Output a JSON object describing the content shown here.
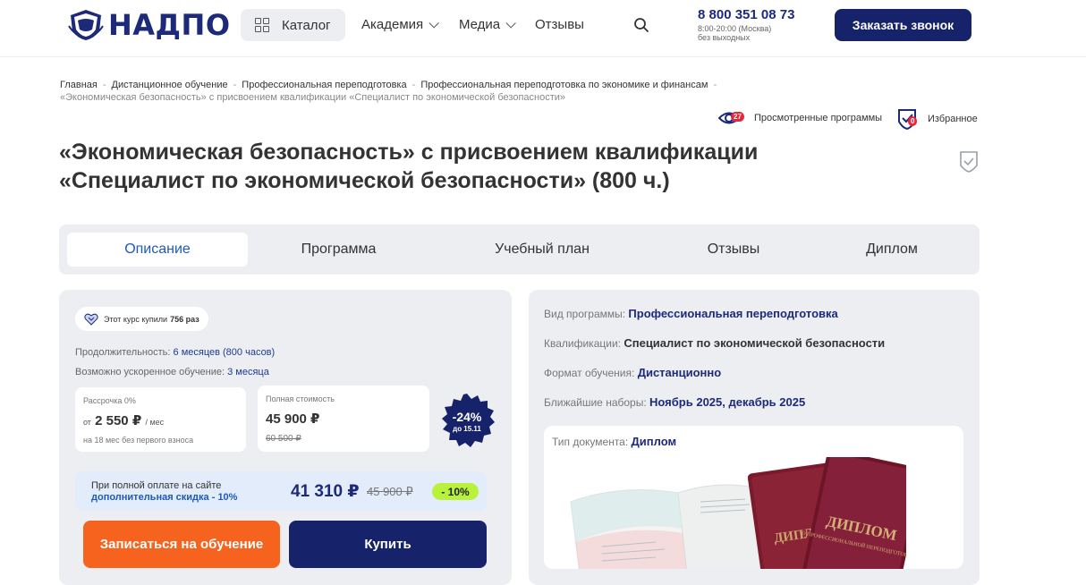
{
  "header": {
    "logo_text": "НАДПО",
    "catalog_label": "Каталог",
    "nav": [
      {
        "label": "Академия",
        "has_dropdown": true
      },
      {
        "label": "Медиа",
        "has_dropdown": true
      },
      {
        "label": "Отзывы",
        "has_dropdown": false
      }
    ],
    "phone": "8 800 351 08 73",
    "hours_line1": "8:00-20:00 (Москва)",
    "hours_line2": "без выходных",
    "callback_label": "Заказать звонок"
  },
  "breadcrumb": {
    "items": [
      "Главная",
      "Дистанционное обучение",
      "Профессиональная переподготовка",
      "Профессиональная переподготовка по экономике и финансам"
    ],
    "current": "«Экономическая безопасность» с присвоением квалификации «Специалист по экономической безопасности»"
  },
  "user_tools": {
    "viewed_label": "Просмотренные программы",
    "viewed_count": "27",
    "favorites_label": "Избранное",
    "favorites_count": "0"
  },
  "page": {
    "title_line1": "«Экономическая безопасность» с присвоением квалификации",
    "title_line2": "«Специалист по экономической безопасности» (800 ч.)"
  },
  "tabs": [
    {
      "label": "Описание",
      "active": true
    },
    {
      "label": "Программа",
      "active": false
    },
    {
      "label": "Учебный план",
      "active": false
    },
    {
      "label": "Отзывы",
      "active": false
    },
    {
      "label": "Диплом",
      "active": false
    }
  ],
  "purchase": {
    "bought_prefix": "Этот курс купили",
    "bought_count": "756 раз",
    "duration_label": "Продолжительность:",
    "duration_value": "6 месяцев (800 часов)",
    "accelerated_label": "Возможно ускоренное обучение:",
    "accelerated_value": "3 месяца",
    "installment": {
      "label": "Рассрочка 0%",
      "prefix": "от",
      "price": "2 550 ₽",
      "per": "/ мес",
      "note": "на 18 мес без первого взноса"
    },
    "full": {
      "label": "Полная стоимость",
      "price": "45 900 ₽",
      "old_price": "60 500 ₽"
    },
    "discount": {
      "percent": "-24%",
      "until": "до 15.11"
    },
    "promo": {
      "line1": "При полной оплате на сайте",
      "line2": "дополнительная скидка - 10%",
      "price": "41 310 ₽",
      "old_price": "45 900 ₽",
      "percent": "- 10%"
    },
    "enroll_label": "Записаться на обучение",
    "buy_label": "Купить"
  },
  "specs": {
    "program_type_label": "Вид программы:",
    "program_type_value": "Профессиональная переподготовка",
    "qualification_label": "Квалификации:",
    "qualification_value": "Специалист по экономической безопасности",
    "format_label": "Формат обучения:",
    "format_value": "Дистанционно",
    "enrollment_label": "Ближайшие наборы:",
    "enrollment_value": "Ноябрь 2025, декабрь 2025",
    "doc_type_label": "Тип документа:",
    "doc_type_value": "Диплом",
    "diploma_cover_text": "ДИПЛОМ",
    "diploma_cover_sub": "О ПРОФЕССИОНАЛЬНОЙ ПЕРЕПОДГОТОВКЕ"
  },
  "colors": {
    "brand_navy": "#16236b",
    "accent_orange": "#f5631f",
    "link_blue": "#1d5ab8",
    "badge_green": "#b8f23a",
    "badge_red": "#e7263a"
  }
}
